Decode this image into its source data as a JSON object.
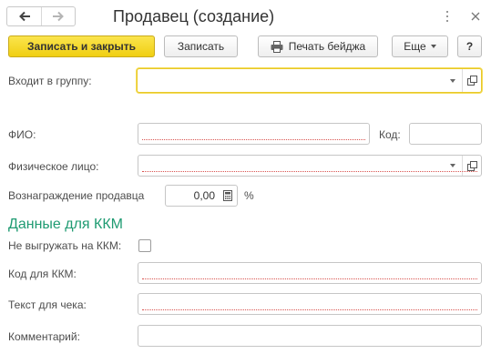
{
  "window": {
    "title": "Продавец (создание)",
    "back_icon": "arrow-left-icon",
    "forward_icon": "arrow-right-icon",
    "menu_icon": "kebab-menu-icon",
    "close_icon": "close-icon"
  },
  "toolbar": {
    "save_close_label": "Записать и закрыть",
    "save_label": "Записать",
    "print_badge_label": "Печать бейджа",
    "print_icon": "printer-icon",
    "more_label": "Еще",
    "help_label": "?"
  },
  "form": {
    "group_label": "Входит в группу:",
    "group_value": "",
    "fio_label": "ФИО:",
    "fio_value": "",
    "code_label": "Код:",
    "code_value": "",
    "person_label": "Физическое лицо:",
    "person_value": "",
    "reward_label": "Вознаграждение продавца",
    "reward_value": "0,00",
    "reward_unit": "%"
  },
  "kkm": {
    "section_title": "Данные для ККМ",
    "no_upload_label": "Не выгружать на ККМ:",
    "no_upload_checked": false,
    "kkm_code_label": "Код для ККМ:",
    "kkm_code_value": "",
    "receipt_text_label": "Текст для чека:",
    "receipt_text_value": "",
    "comment_label": "Комментарий:",
    "comment_value": ""
  },
  "colors": {
    "accent_yellow": "#f0cf12",
    "section_green": "#1f9b72",
    "required_red": "#d9534f"
  }
}
